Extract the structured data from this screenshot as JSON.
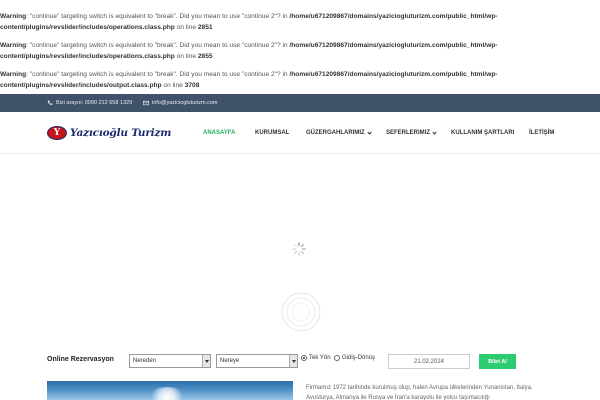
{
  "warnings": [
    {
      "label": "Warning",
      "message": ": \"continue\" targeting switch is equivalent to \"break\". Did you mean to use \"continue 2\"? in ",
      "path": "/home/u671209867/domains/yaziciogluturizm.com/public_html/wp-content/plugins/revslider/includes/operations.class.php",
      "on_line": " on line ",
      "line": "2851"
    },
    {
      "label": "Warning",
      "message": ": \"continue\" targeting switch is equivalent to \"break\". Did you mean to use \"continue 2\"? in ",
      "path": "/home/u671209867/domains/yaziciogluturizm.com/public_html/wp-content/plugins/revslider/includes/operations.class.php",
      "on_line": " on line ",
      "line": "2855"
    },
    {
      "label": "Warning",
      "message": ": \"continue\" targeting switch is equivalent to \"break\". Did you mean to use \"continue 2\"? in ",
      "path": "/home/u671209867/domains/yaziciogluturizm.com/public_html/wp-content/plugins/revslider/includes/output.class.php",
      "on_line": " on line ",
      "line": "3708"
    }
  ],
  "topbar": {
    "phone": "Bizi arayın: 0090 212 658 1329",
    "email": "info@yaziciogluturizm.com",
    "phone_icon": "phone-icon",
    "email_icon": "mail-icon",
    "bg_color": "#40526a"
  },
  "logo": {
    "badge": "Y",
    "text": "Yazıcıoğlu Turizm"
  },
  "nav": {
    "items": [
      {
        "label": "ANASAYFA",
        "active": true
      },
      {
        "label": "KURUMSAL"
      },
      {
        "label": "GÜZERGAHLARIMIZ",
        "dropdown": true
      },
      {
        "label": "SEFERLERIMIZ",
        "dropdown": true
      },
      {
        "label": "KULLANIM ŞARTLARI"
      },
      {
        "label": "İLETİŞİM"
      }
    ],
    "active_color": "#27ae60"
  },
  "booking": {
    "title": "Online Rezervasyon",
    "from_value": "Nereden",
    "to_value": "Nereye",
    "one_way": "Tek Yön",
    "round_trip": "Gidiş-Dönüş",
    "date": "21.02.2024",
    "button": "Bilet Al",
    "button_color": "#2ecc71"
  },
  "about": {
    "text": "Firmamız 1972 tarihinde kurulmuş olup, halen Avrupa ülkelerinden Yunanistan, İtalya, Avusturya, Almanya ile Rusya ve İran'a karayolu ile yolcu taşımacılığı"
  }
}
